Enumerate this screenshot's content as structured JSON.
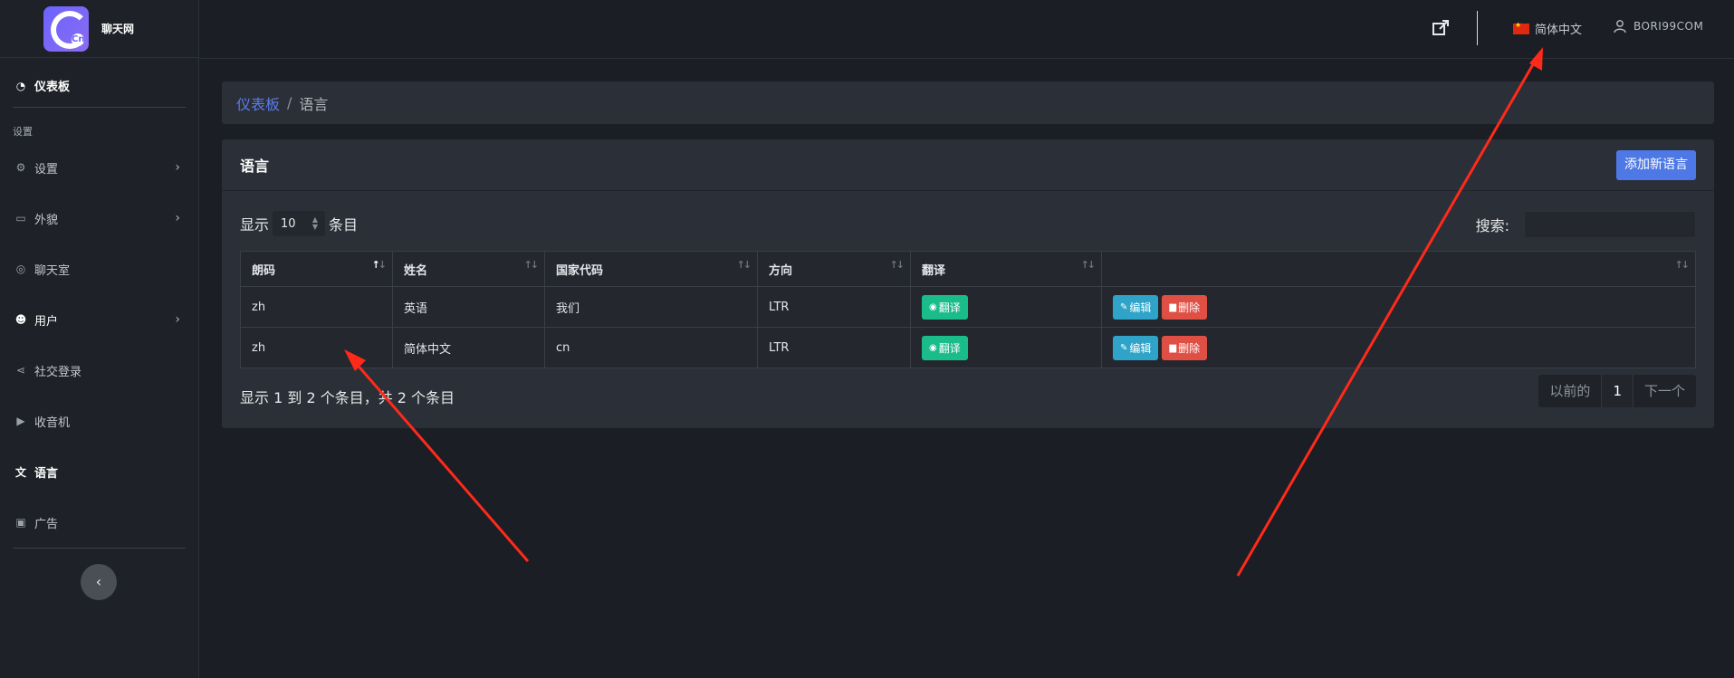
{
  "app": {
    "logo_mark": "Cn",
    "logo_text": "聊天网"
  },
  "sidebar": {
    "dashboard": "仪表板",
    "section_label": "设置",
    "items": [
      {
        "label": "设置",
        "icon": "gear-icon",
        "has_children": true
      },
      {
        "label": "外貌",
        "icon": "card-icon",
        "has_children": true
      },
      {
        "label": "聊天室",
        "icon": "chat-icon",
        "has_children": false
      },
      {
        "label": "用户",
        "icon": "users-icon",
        "has_children": true
      },
      {
        "label": "社交登录",
        "icon": "share-icon",
        "has_children": false
      },
      {
        "label": "收音机",
        "icon": "play-icon",
        "has_children": false
      },
      {
        "label": "语言",
        "icon": "language-icon",
        "has_children": false,
        "active": true
      },
      {
        "label": "广告",
        "icon": "ad-icon",
        "has_children": false
      }
    ]
  },
  "topbar": {
    "language": "简体中文",
    "username": "BORI99COM"
  },
  "breadcrumb": {
    "home": "仪表板",
    "sep": "/",
    "current": "语言"
  },
  "card": {
    "title": "语言",
    "add_button": "添加新语言",
    "show_prefix": "显示",
    "page_length": "10",
    "show_suffix": "条目",
    "search_label": "搜索:",
    "search_value": "",
    "columns": [
      "朗码",
      "姓名",
      "国家代码",
      "方向",
      "翻译",
      ""
    ],
    "rows": [
      {
        "code": "zh",
        "name": "英语",
        "country": "我们",
        "direction": "LTR"
      },
      {
        "code": "zh",
        "name": "简体中文",
        "country": "cn",
        "direction": "LTR"
      }
    ],
    "translate_label": "翻译",
    "edit_label": "编辑",
    "delete_label": "删除",
    "info": "显示 1 到 2 个条目，共 2 个条目",
    "pager": {
      "prev": "以前的",
      "current": "1",
      "next": "下一个"
    }
  },
  "colors": {
    "accent": "#4d78e6",
    "green": "#1abc8a",
    "blue": "#2fa4c8",
    "red": "#e04f43",
    "annotation": "#ff2a1a"
  }
}
